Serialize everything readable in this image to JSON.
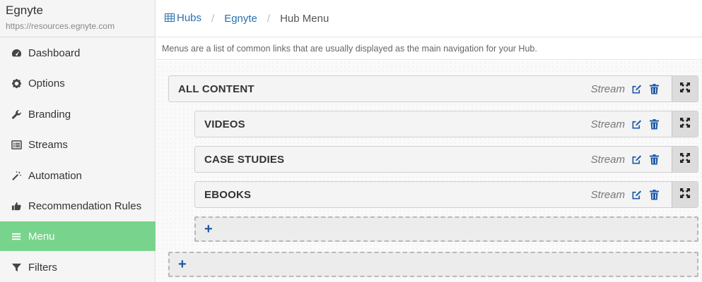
{
  "app": {
    "name": "Egnyte",
    "url": "https://resources.egnyte.com"
  },
  "sidebar": {
    "items": [
      {
        "label": "Dashboard",
        "icon": "dashboard-icon"
      },
      {
        "label": "Options",
        "icon": "gear-icon"
      },
      {
        "label": "Branding",
        "icon": "wrench-icon"
      },
      {
        "label": "Streams",
        "icon": "list-alt-icon"
      },
      {
        "label": "Automation",
        "icon": "magic-wand-icon"
      },
      {
        "label": "Recommendation Rules",
        "icon": "thumbs-up-icon"
      },
      {
        "label": "Menu",
        "icon": "bars-icon",
        "active": true
      },
      {
        "label": "Filters",
        "icon": "filter-icon"
      }
    ]
  },
  "breadcrumb": {
    "hubs": "Hubs",
    "hub": "Egnyte",
    "current": "Hub Menu",
    "separator": "/"
  },
  "description": "Menus are a list of common links that are usually displayed as the main navigation for your Hub.",
  "menu": {
    "items": [
      {
        "label": "ALL CONTENT",
        "type": "Stream",
        "level": 0
      },
      {
        "label": "VIDEOS",
        "type": "Stream",
        "level": 1
      },
      {
        "label": "CASE STUDIES",
        "type": "Stream",
        "level": 1
      },
      {
        "label": "EBOOKS",
        "type": "Stream",
        "level": 1
      }
    ],
    "add_symbol": "+"
  },
  "colors": {
    "accent": "#78d48c",
    "link": "#2a6fae",
    "icon_blue": "#1e5aa8"
  }
}
